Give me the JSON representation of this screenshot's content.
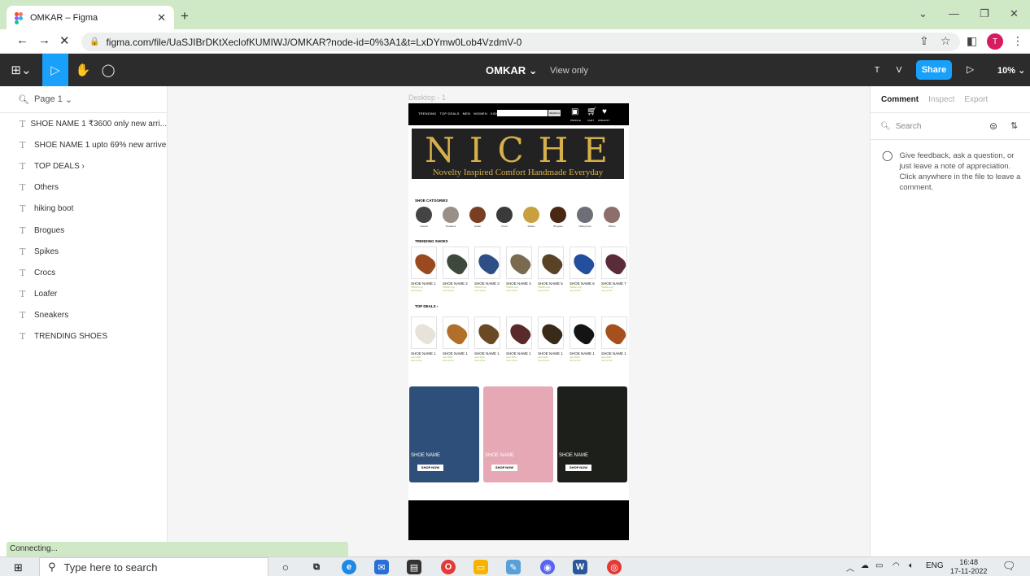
{
  "browser": {
    "tab_title": "OMKAR – Figma",
    "tab_close": "✕",
    "new_tab": "+",
    "url": "figma.com/file/UaSJIBrDKtXeclofKUMIWJ/OMKAR?node-id=0%3A1&t=LxDYmw0Lob4VzdmV-0",
    "colors": {
      "tabstrip": "#cfe8c6"
    }
  },
  "figma": {
    "file_name": "OMKAR",
    "view_mode": "View only",
    "avatars": [
      {
        "letter": "T",
        "color": "#1e88e5"
      },
      {
        "letter": "V",
        "color": "#f4b400"
      }
    ],
    "share_label": "Share",
    "zoom": "10%",
    "page_name": "Page 1",
    "layers": [
      {
        "type": "text",
        "name": "SHOE NAME 1 ₹3600 only new arri..."
      },
      {
        "type": "text",
        "name": "SHOE NAME 1 upto 69% new arrive"
      },
      {
        "type": "text",
        "name": "TOP DEALS ›"
      },
      {
        "type": "text",
        "name": "Others"
      },
      {
        "type": "text",
        "name": "hiking boot"
      },
      {
        "type": "text",
        "name": "Brogues"
      },
      {
        "type": "text",
        "name": "Spikes"
      },
      {
        "type": "text",
        "name": "Crocs"
      },
      {
        "type": "text",
        "name": "Loafer"
      },
      {
        "type": "text",
        "name": "Sneakers"
      },
      {
        "type": "text",
        "name": "TRENDING SHOES"
      },
      {
        "type": "frame",
        "name": "heart"
      },
      {
        "type": "frame",
        "name": "shopping-cart"
      },
      {
        "type": "frame",
        "name": "shopping-cart"
      },
      {
        "type": "frame",
        "name": "Desktop - 1"
      },
      {
        "type": "frame",
        "name": "accessible-icon"
      }
    ],
    "frame_label": "Desktop - 1",
    "right_tabs": [
      "Comment",
      "Inspect",
      "Export"
    ],
    "right_search_placeholder": "Search",
    "comment_hint": "Give feedback, ask a question, or just leave a note of appreciation. Click anywhere in the file to leave a comment.",
    "help_label": "?",
    "status": "Connecting..."
  },
  "design": {
    "nav_links": [
      "TRENDING",
      "TOP DEALS",
      "MEN",
      "WOMEN",
      "KIDS"
    ],
    "search_btn": "SEARCH",
    "icon_labels": [
      "PROFILE",
      "CART",
      "WISHLIST"
    ],
    "brand": "NICHE",
    "tagline": "Novelty Inspired Comfort Handmade Everyday",
    "categories_title": "SHOE CATOGRIES",
    "categories": [
      {
        "label": "Casual",
        "color": "#444"
      },
      {
        "label": "Sneakers",
        "color": "#9a8f86"
      },
      {
        "label": "Loafer",
        "color": "#7a3e24"
      },
      {
        "label": "Crocs",
        "color": "#3a3a3a"
      },
      {
        "label": "Spikes",
        "color": "#c8a040"
      },
      {
        "label": "Brogues",
        "color": "#4a2614"
      },
      {
        "label": "Hiking boot",
        "color": "#6e6e78"
      },
      {
        "label": "Others",
        "color": "#8c6e6a"
      }
    ],
    "trending_title": "TRENDING SHOES",
    "trending": [
      {
        "name": "SHOE NAME 1",
        "price": "₹3600 only",
        "tag": "new arrive",
        "color": "#9b4a1f"
      },
      {
        "name": "SHOE NAME 2",
        "price": "₹3600 only",
        "tag": "new arrive",
        "color": "#3d4a3b"
      },
      {
        "name": "SHOE NAME 3",
        "price": "₹3600 only",
        "tag": "new arrive",
        "color": "#2e4f86"
      },
      {
        "name": "SHOE NAME 4",
        "price": "₹3600 only",
        "tag": "new arrive",
        "color": "#7a6a50"
      },
      {
        "name": "SHOE NAME 5",
        "price": "₹3600 only",
        "tag": "new arrive",
        "color": "#5a4324"
      },
      {
        "name": "SHOE NAME 6",
        "price": "₹3600 only",
        "tag": "new arrive",
        "color": "#244e9e"
      },
      {
        "name": "SHOE NAME 7",
        "price": "₹3600 only",
        "tag": "new arrive",
        "color": "#5a2c3a"
      }
    ],
    "deals_title": "TOP DEALS ›",
    "deals": [
      {
        "name": "SHOE NAME 1",
        "price": "upto 69%",
        "tag": "new arrive",
        "color": "#e7e2da"
      },
      {
        "name": "SHOE NAME 1",
        "price": "upto 69%",
        "tag": "new arrive",
        "color": "#b0702a"
      },
      {
        "name": "SHOE NAME 1",
        "price": "upto 69%",
        "tag": "new arrive",
        "color": "#6a4a24"
      },
      {
        "name": "SHOE NAME 1",
        "price": "upto 69%",
        "tag": "new arrive",
        "color": "#5a2a2a"
      },
      {
        "name": "SHOE NAME 1",
        "price": "upto 69%",
        "tag": "new arrive",
        "color": "#3a2a1a"
      },
      {
        "name": "SHOE NAME 1",
        "price": "upto 69%",
        "tag": "new arrive",
        "color": "#141414"
      },
      {
        "name": "SHOE NAME 1",
        "price": "upto 69%",
        "tag": "new arrive",
        "color": "#a6501e"
      }
    ],
    "promos": [
      {
        "name": "SHOE NAME",
        "cta": "SHOP NOW",
        "bg": "#2d4f7a"
      },
      {
        "name": "SHOE NAME",
        "cta": "SHOP NOW",
        "bg": "#e6a8b4"
      },
      {
        "name": "SHOE NAME",
        "cta": "SHOP NOW",
        "bg": "#1d1f1a"
      }
    ]
  },
  "taskbar": {
    "search_placeholder": "Type here to search",
    "lang": "ENG",
    "time": "16:48",
    "date": "17-11-2022"
  }
}
